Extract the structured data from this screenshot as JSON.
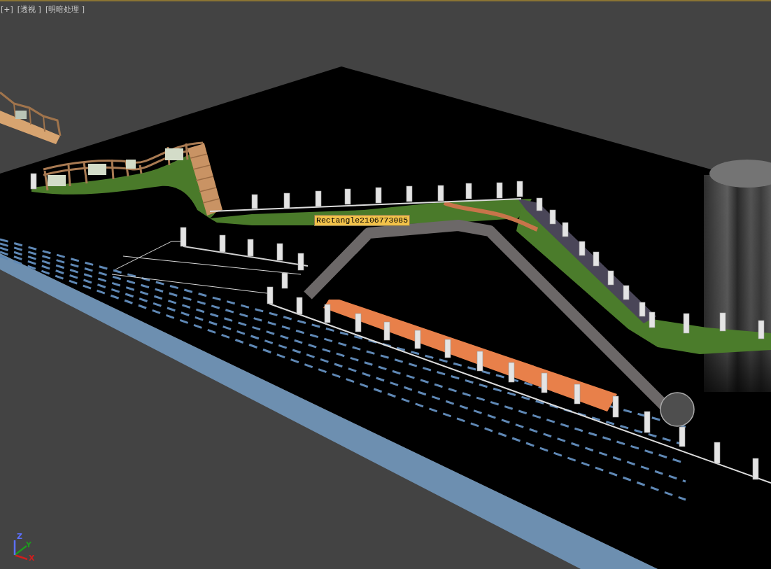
{
  "viewport": {
    "active": true,
    "labels": [
      "[+]",
      "[透视 ]",
      "[明暗处理 ]"
    ],
    "tooltip": "Rectangle2106773085",
    "axis_gizmo": [
      {
        "label": "Z",
        "color": "#5c70ff"
      },
      {
        "label": "Y",
        "color": "#1e9a1e"
      },
      {
        "label": "X",
        "color": "#d01e1e"
      }
    ]
  }
}
